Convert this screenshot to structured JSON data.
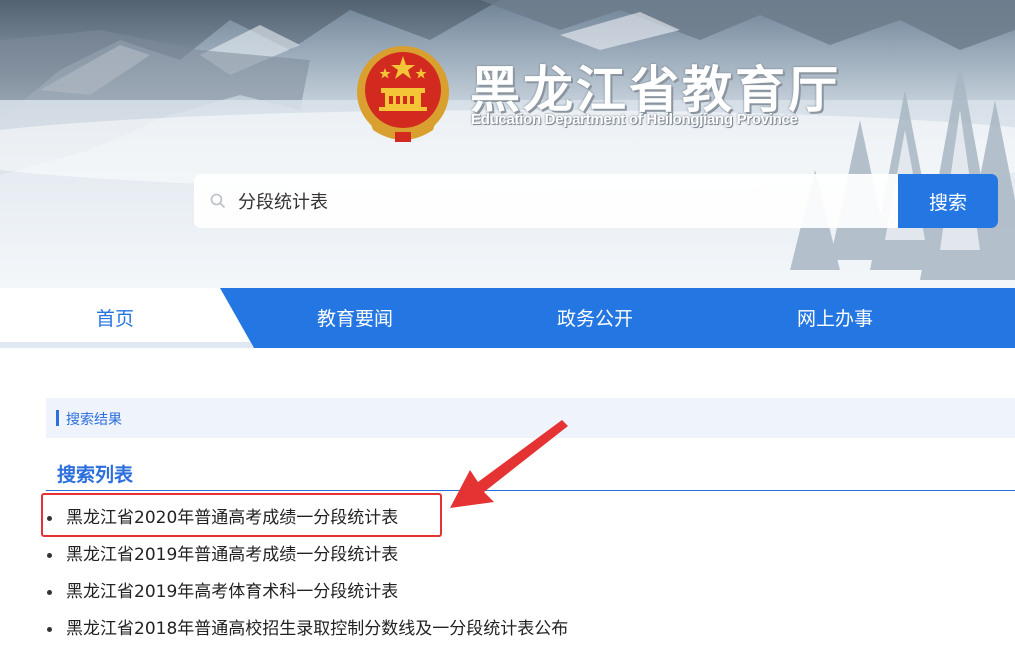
{
  "header": {
    "title": "黑龙江省教育厅",
    "subtitle": "Education Department of Heilongjiang Province",
    "emblem_icon": "national-emblem-icon"
  },
  "search": {
    "value": "分段统计表",
    "button_label": "搜索",
    "icon": "search-icon"
  },
  "nav": {
    "items": [
      {
        "label": "首页",
        "active": true
      },
      {
        "label": "教育要闻",
        "active": false
      },
      {
        "label": "政务公开",
        "active": false
      },
      {
        "label": "网上办事",
        "active": false
      }
    ],
    "active_color": "#2476e2",
    "bar_color": "#2476e2"
  },
  "results": {
    "section_label": "搜索结果",
    "list_title": "搜索列表",
    "items": [
      "黑龙江省2020年普通高考成绩一分段统计表",
      "黑龙江省2019年普通高考成绩一分段统计表",
      "黑龙江省2019年高考体育术科一分段统计表",
      "黑龙江省2018年普通高校招生录取控制分数线及一分段统计表公布"
    ]
  },
  "annotation": {
    "highlight_color": "#e53232",
    "arrow_icon": "red-arrow-icon"
  }
}
